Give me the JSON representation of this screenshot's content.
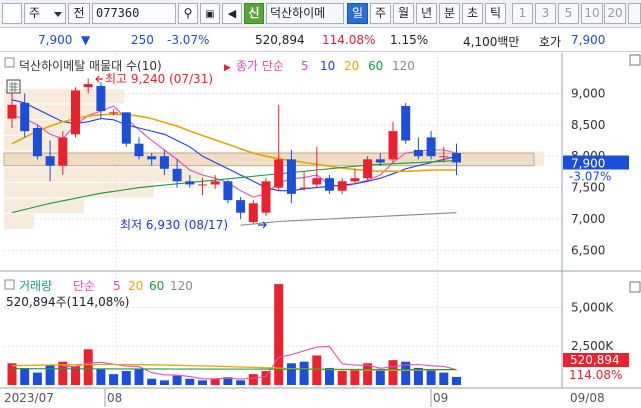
{
  "toolbar": {
    "dropdown_label": "주",
    "jeon_label": "전",
    "stock_code": "077360",
    "sin_label": "신",
    "stock_name": "덕산하이메",
    "periods": [
      "일",
      "주",
      "월",
      "년",
      "분",
      "초",
      "틱"
    ],
    "selected_period": "일",
    "minute_numbers": [
      "1",
      "3",
      "5",
      "10",
      "20"
    ]
  },
  "price_bar": {
    "price": "7,900",
    "change": "250",
    "change_pct": "-3.07%",
    "volume": "520,894",
    "volume_ratio": "114.08%",
    "turnover": "1.15%",
    "amount": "4,100백만",
    "quote_label": "호가",
    "quote_price": "7,900"
  },
  "chart_data": [
    {
      "type": "candlestick",
      "legend": {
        "stock_name": "덕산하이메탈",
        "extra": "매물대 수(10)",
        "ma_label": "종가 단순",
        "ma_periods": [
          "5",
          "10",
          "20",
          "60",
          "120"
        ],
        "ma_colors": [
          "#e64cc0",
          "#1e3cf0",
          "#e8a600",
          "#1e9a3c",
          "#8a8a8a"
        ]
      },
      "y_ticks": [
        "9,000",
        "8,500",
        "8,000",
        "7,500",
        "7,000",
        "6,500"
      ],
      "ylim": [
        6250,
        9550
      ],
      "current_price_label": "7,900",
      "current_change_label": "-3.07%",
      "high_annotation": "최고 9,240 (07/31)",
      "low_annotation": "최저 6,930 (08/17)",
      "candles": [
        {
          "o": 8600,
          "h": 9000,
          "l": 8450,
          "c": 8820
        },
        {
          "o": 8850,
          "h": 9000,
          "l": 8300,
          "c": 8400
        },
        {
          "o": 8450,
          "h": 8500,
          "l": 7950,
          "c": 8000
        },
        {
          "o": 8000,
          "h": 8250,
          "l": 7600,
          "c": 7850
        },
        {
          "o": 7850,
          "h": 8400,
          "l": 7700,
          "c": 8300
        },
        {
          "o": 8350,
          "h": 9100,
          "l": 8300,
          "c": 9050
        },
        {
          "o": 9100,
          "h": 9240,
          "l": 9000,
          "c": 9150
        },
        {
          "o": 9120,
          "h": 9180,
          "l": 8600,
          "c": 8720
        },
        {
          "o": 8700,
          "h": 8750,
          "l": 8650,
          "c": 8700
        },
        {
          "o": 8700,
          "h": 8700,
          "l": 8150,
          "c": 8200
        },
        {
          "o": 8200,
          "h": 8300,
          "l": 7950,
          "c": 8000
        },
        {
          "o": 8000,
          "h": 8050,
          "l": 7850,
          "c": 7950
        },
        {
          "o": 8000,
          "h": 8100,
          "l": 7700,
          "c": 7800
        },
        {
          "o": 7800,
          "h": 7950,
          "l": 7500,
          "c": 7600
        },
        {
          "o": 7600,
          "h": 7700,
          "l": 7500,
          "c": 7550
        },
        {
          "o": 7550,
          "h": 7650,
          "l": 7380,
          "c": 7550
        },
        {
          "o": 7550,
          "h": 7700,
          "l": 7480,
          "c": 7600
        },
        {
          "o": 7600,
          "h": 7620,
          "l": 7250,
          "c": 7300
        },
        {
          "o": 7300,
          "h": 7350,
          "l": 7000,
          "c": 7100
        },
        {
          "o": 6950,
          "h": 7300,
          "l": 6930,
          "c": 7250
        },
        {
          "o": 7100,
          "h": 7650,
          "l": 7050,
          "c": 7600
        },
        {
          "o": 7500,
          "h": 8820,
          "l": 7450,
          "c": 7950
        },
        {
          "o": 7950,
          "h": 8100,
          "l": 7250,
          "c": 7400
        },
        {
          "o": 7500,
          "h": 7750,
          "l": 7450,
          "c": 7500
        },
        {
          "o": 7550,
          "h": 8150,
          "l": 7500,
          "c": 7650
        },
        {
          "o": 7650,
          "h": 7700,
          "l": 7400,
          "c": 7450
        },
        {
          "o": 7450,
          "h": 7650,
          "l": 7400,
          "c": 7600
        },
        {
          "o": 7600,
          "h": 7800,
          "l": 7550,
          "c": 7650
        },
        {
          "o": 7650,
          "h": 8000,
          "l": 7620,
          "c": 7950
        },
        {
          "o": 7950,
          "h": 8050,
          "l": 7850,
          "c": 7900
        },
        {
          "o": 7950,
          "h": 8550,
          "l": 7900,
          "c": 8400
        },
        {
          "o": 8800,
          "h": 8850,
          "l": 8200,
          "c": 8250
        },
        {
          "o": 8100,
          "h": 8300,
          "l": 7950,
          "c": 8000
        },
        {
          "o": 8300,
          "h": 8400,
          "l": 7950,
          "c": 8000
        },
        {
          "o": 8000,
          "h": 8150,
          "l": 7900,
          "c": 8000
        },
        {
          "o": 8050,
          "h": 8200,
          "l": 7700,
          "c": 7900
        }
      ],
      "ma": {
        "5": [
          8650,
          8600,
          8500,
          8350,
          8280,
          8500,
          8650,
          8720,
          8800,
          8600,
          8420,
          8250,
          8100,
          7950,
          7780,
          7700,
          7650,
          7580,
          7450,
          7350,
          7400,
          7580,
          7640,
          7660,
          7700,
          7550,
          7520,
          7560,
          7620,
          7700,
          7900,
          8050,
          8080,
          8100,
          8100,
          8050
        ],
        "10": [
          8900,
          8850,
          8750,
          8650,
          8550,
          8520,
          8550,
          8600,
          8580,
          8500,
          8450,
          8400,
          8350,
          8250,
          8150,
          8000,
          7900,
          7800,
          7700,
          7600,
          7500,
          7450,
          7450,
          7480,
          7500,
          7520,
          7540,
          7560,
          7600,
          7650,
          7720,
          7800,
          7850,
          7900,
          7950,
          8000
        ],
        "20": [
          8200,
          8300,
          8400,
          8480,
          8550,
          8600,
          8640,
          8660,
          8670,
          8660,
          8640,
          8600,
          8540,
          8480,
          8400,
          8330,
          8260,
          8190,
          8120,
          8050,
          8000,
          7960,
          7930,
          7900,
          7870,
          7840,
          7810,
          7790,
          7770,
          7760,
          7760,
          7760,
          7770,
          7780,
          7780,
          7780
        ],
        "60": [
          7100,
          7150,
          7200,
          7250,
          7290,
          7330,
          7370,
          7410,
          7440,
          7470,
          7500,
          7520,
          7540,
          7560,
          7580,
          7600,
          7620,
          7640,
          7660,
          7680,
          7700,
          7720,
          7740,
          7760,
          7780,
          7800,
          7820,
          7840,
          7860,
          7870,
          7880,
          7890,
          7900,
          7910,
          7920,
          7930
        ],
        "120": [
          null,
          null,
          null,
          null,
          null,
          null,
          null,
          null,
          null,
          null,
          null,
          null,
          null,
          null,
          null,
          null,
          null,
          null,
          6900,
          6920,
          6940,
          6960,
          6970,
          6980,
          6990,
          7000,
          7010,
          7020,
          7030,
          7040,
          7050,
          7060,
          7070,
          7080,
          7090,
          7100
        ]
      }
    },
    {
      "type": "bar",
      "legend": {
        "title": "거래량",
        "ma_label": "단순",
        "ma_periods": [
          "5",
          "20",
          "60",
          "120"
        ],
        "ma_colors": [
          "#e64cc0",
          "#e8a600",
          "#1e9a3c",
          "#8a8a8a"
        ],
        "volume_text": "520,894주(114,08%)"
      },
      "y_ticks": [
        "5,000K",
        "2,500K"
      ],
      "ylim": [
        0,
        6700
      ],
      "current_volume_label": "520,894",
      "current_ratio_label": "114.08%",
      "values": [
        1400,
        1100,
        800,
        1300,
        1500,
        1200,
        2300,
        1000,
        700,
        900,
        1000,
        400,
        300,
        600,
        400,
        300,
        400,
        500,
        300,
        700,
        900,
        6500,
        1400,
        1500,
        1900,
        1100,
        900,
        1000,
        1400,
        1000,
        1600,
        1500,
        1100,
        1000,
        800,
        520
      ],
      "colors": [
        "red",
        "blue",
        "blue",
        "blue",
        "red",
        "red",
        "red",
        "blue",
        "blue",
        "blue",
        "blue",
        "blue",
        "blue",
        "blue",
        "blue",
        "blue",
        "red",
        "blue",
        "blue",
        "red",
        "red",
        "red",
        "blue",
        "blue",
        "red",
        "blue",
        "red",
        "red",
        "red",
        "blue",
        "red",
        "blue",
        "blue",
        "blue",
        "blue",
        "blue"
      ],
      "x_labels": [
        "2023/07",
        "08",
        "09",
        "09/08"
      ]
    }
  ]
}
